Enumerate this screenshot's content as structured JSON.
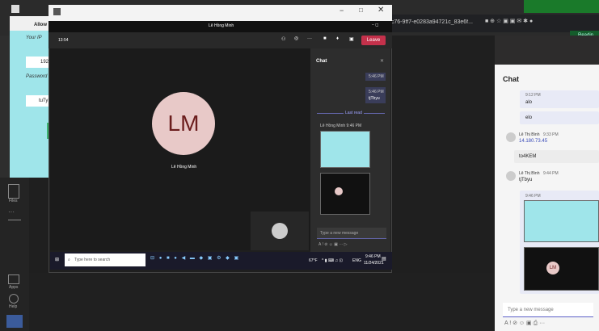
{
  "browser": {
    "address": "4c76-9ff7-e0283a94721c_83e6f...",
    "reading_label": "Readin"
  },
  "remote_panel": {
    "allow_label": "Allow R",
    "your_ip_label": "Your IP",
    "ip_value": "192",
    "password_label": "Password",
    "password_value": "tuTy"
  },
  "meeting": {
    "window_title": "Lê Hồng Minh",
    "timer": "13:54",
    "leave_label": "Leave",
    "avatar_initials": "LM",
    "participant_name": "Lê Hồng Minh"
  },
  "meeting_chat": {
    "title": "Chat",
    "msg1_meta": "5:46 PM",
    "msg2_meta": "5:46 PM",
    "msg2_text": "tjTbyu",
    "last_read": "Last read",
    "sender_line": "Lê Hồng Minh  9:46 PM",
    "input_placeholder": "Type a new message"
  },
  "taskbar": {
    "search_placeholder": "Type here to search",
    "temp": "67°F",
    "lang": "ENG",
    "time": "9:46 PM",
    "date": "11/24/2021"
  },
  "right_chat": {
    "title": "Chat",
    "msg1_time": "9:12 PM",
    "msg1_text": "alo",
    "msg2_text": "elo",
    "msg3_sender": "Lê Thị Bình",
    "msg3_time": "9:33 PM",
    "msg3_text": "14.180.73.45",
    "msg4_text": "to4KEM",
    "msg5_sender": "Lê Thị Bình",
    "msg5_time": "9:44 PM",
    "msg5_text": "tjTbyu",
    "msg6_time": "9:46 PM",
    "input_placeholder": "Type a new message"
  },
  "left_strip": {
    "files_label": "Files",
    "apps_label": "Apps",
    "help_label": "Help"
  }
}
